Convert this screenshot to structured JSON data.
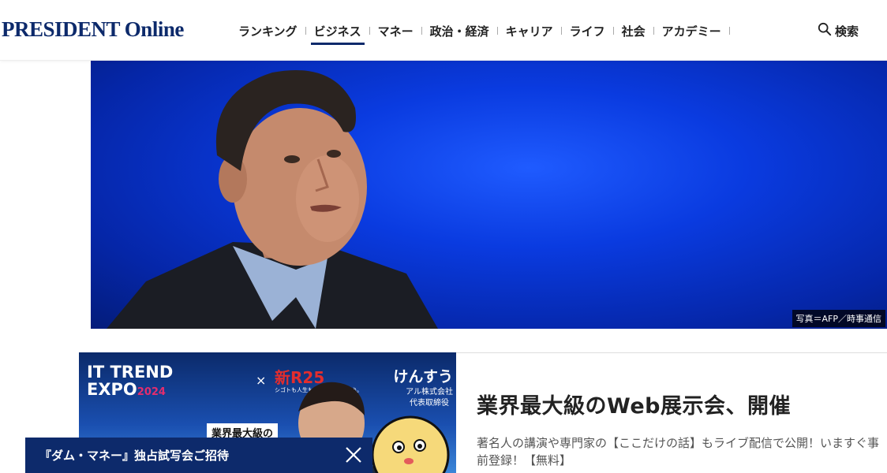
{
  "header": {
    "logo": "PRESIDENT Online",
    "nav": [
      "ランキング",
      "ビジネス",
      "マネー",
      "政治・経済",
      "キャリア",
      "ライフ",
      "社会",
      "アカデミー"
    ],
    "active_nav": "ビジネス",
    "search_label": "検索"
  },
  "hero": {
    "photo_credit": "写真＝AFP／時事通信"
  },
  "ad": {
    "expo_line1": "IT TREND",
    "expo_line2": "EXPO",
    "expo_year": "2024",
    "times": "×",
    "r25": "新R25",
    "r25_tagline": "シゴトも人生も、もっと楽しもう。",
    "guest_name": "けんすう",
    "guest_company": "アル株式会社",
    "guest_title": "代表取締役",
    "badge": "業界最大級の"
  },
  "article": {
    "title": "業界最大級のWeb展示会、開催",
    "description": "著名人の講演や専門家の【ここだけの話】もライブ配信で公開！いますぐ事前登録！【無料】"
  },
  "float_bar": {
    "label": "『ダム・マネー』独占試写会ご招待"
  },
  "colors": {
    "brand_navy": "#0d2a6b",
    "hero_blue": "#0a3be0"
  }
}
